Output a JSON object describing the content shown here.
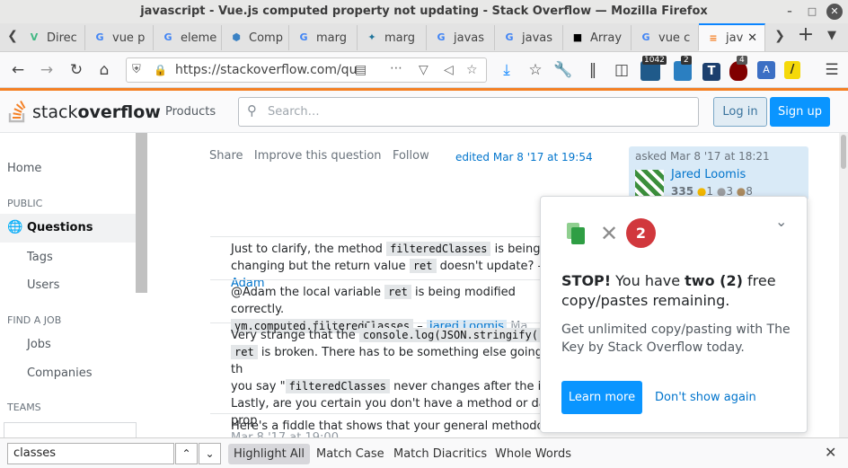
{
  "window": {
    "title": "javascript - Vue.js computed property not updating - Stack Overflow — Mozilla Firefox"
  },
  "tabs": [
    {
      "label": "Direc",
      "favicon": "vue-icon",
      "favicon_glyph": "V",
      "favicon_color": "#41b883"
    },
    {
      "label": "vue p",
      "favicon": "google-icon",
      "favicon_glyph": "G",
      "favicon_color": "#4285f4"
    },
    {
      "label": "eleme",
      "favicon": "google-icon",
      "favicon_glyph": "G",
      "favicon_color": "#4285f4"
    },
    {
      "label": "Comp",
      "favicon": "shield-site-icon",
      "favicon_glyph": "⬢",
      "favicon_color": "#3b82c4"
    },
    {
      "label": "marg",
      "favicon": "google-icon",
      "favicon_glyph": "G",
      "favicon_color": "#4285f4"
    },
    {
      "label": "marg",
      "favicon": "wordpress-icon",
      "favicon_glyph": "✦",
      "favicon_color": "#21759b"
    },
    {
      "label": "javas",
      "favicon": "google-icon",
      "favicon_glyph": "G",
      "favicon_color": "#4285f4"
    },
    {
      "label": "javas",
      "favicon": "google-icon",
      "favicon_glyph": "G",
      "favicon_color": "#4285f4"
    },
    {
      "label": "Array",
      "favicon": "mdn-icon",
      "favicon_glyph": "■",
      "favicon_color": "#000000"
    },
    {
      "label": "vue c",
      "favicon": "google-icon",
      "favicon_glyph": "G",
      "favicon_color": "#4285f4"
    },
    {
      "label": "jav",
      "favicon": "stackoverflow-icon",
      "favicon_glyph": "≡",
      "favicon_color": "#f48024"
    }
  ],
  "navbar": {
    "url": "https://stackoverflow.com/qu",
    "badge_1042": "1042",
    "badge_2": "2",
    "badge_4": "4"
  },
  "so": {
    "logo_stack": "stack",
    "logo_overflow": "overflow",
    "products": "Products",
    "search_placeholder": "Search…",
    "login": "Log in",
    "signup": "Sign up"
  },
  "leftnav": {
    "home": "Home",
    "public": "PUBLIC",
    "questions": "Questions",
    "tags": "Tags",
    "users": "Users",
    "find_a_job": "FIND A JOB",
    "jobs": "Jobs",
    "companies": "Companies",
    "teams": "TEAMS"
  },
  "post": {
    "share": "Share",
    "improve": "Improve this question",
    "follow": "Follow",
    "edited": "edited Mar 8 '17 at 19:54",
    "asked": "asked Mar 8 '17 at 18:21",
    "user": "Jared Loomis",
    "rep": "335",
    "gold": "1",
    "silver": "3",
    "bronze": "8"
  },
  "comments": {
    "c1_a": "Just to clarify, the method",
    "c1_code": "filteredClasses",
    "c1_b": "is being ru",
    "c1_c": "changing but the return value",
    "c1_code2": "ret",
    "c1_d": "doesn't update? –",
    "c1_user": "Adam",
    "c2_a": "@Adam the local variable",
    "c2_code": "ret",
    "c2_b": "is being modified correctly.",
    "c2_code2": "vm.computed.filteredClasses",
    "c2_dash": "–",
    "c2_user": "Jared Loomis",
    "c2_date": "Ma",
    "c3_a": "Very strange that the",
    "c3_code": "console.log(JSON.stringify(r",
    "c3_code2": "ret",
    "c3_b": "is broken. There has to be something else going on, th",
    "c3_c": "you say \"",
    "c3_code3": "filteredClasses",
    "c3_d": "never changes after the initi",
    "c3_e": "Lastly, are you certain you don't have a method or data prop",
    "c3_date": "Mar 8 '17 at 19:00",
    "c4_a": "Here's a fiddle that shows that your general methodology sh"
  },
  "popup": {
    "count": "2",
    "stop": "STOP!",
    "line_a": " You have ",
    "two": "two (2)",
    "line_b": " free copy/pastes remaining.",
    "body": "Get unlimited copy/pasting with The Key by Stack Overflow today.",
    "learn_more": "Learn more",
    "dont_show": "Don't show again"
  },
  "findbar": {
    "value": "classes",
    "highlight_all": "Highlight All",
    "match_case": "Match Case",
    "match_diacritics": "Match Diacritics",
    "whole_words": "Whole Words"
  },
  "colors": {
    "accent": "#f48024",
    "link": "#0074cc",
    "primary_button": "#0a95ff",
    "badge_red": "#d1383d"
  }
}
